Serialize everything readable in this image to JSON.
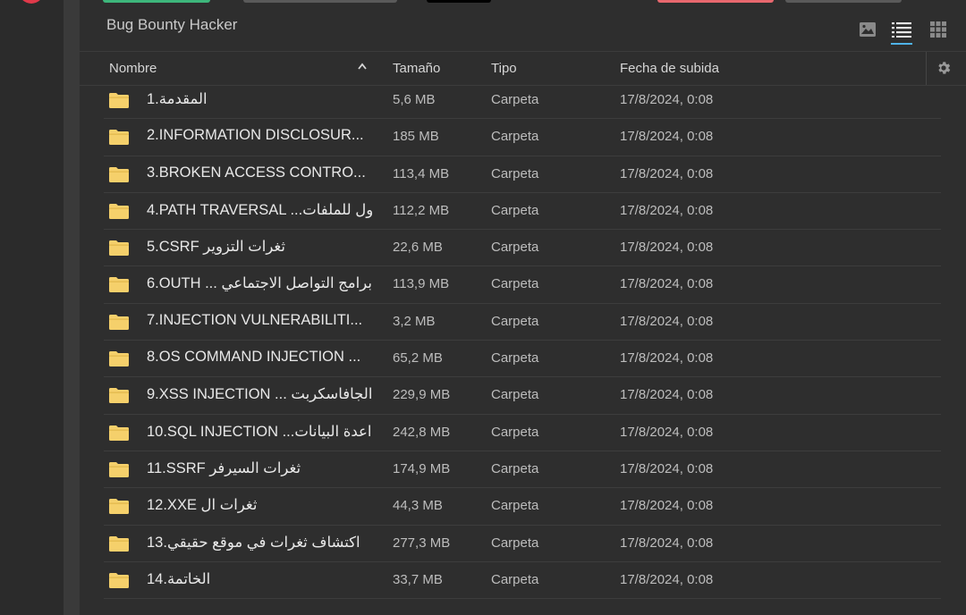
{
  "folder": {
    "title": "Bug Bounty Hacker"
  },
  "view_switcher": {
    "icons": [
      "image-icon",
      "list-icon",
      "grid-icon"
    ],
    "active": "list"
  },
  "table": {
    "headers": {
      "name": "Nombre",
      "size": "Tamaño",
      "type": "Tipo",
      "date": "Fecha de subida"
    },
    "sort": {
      "column": "name",
      "direction": "ascending"
    },
    "rows": [
      {
        "name": "1.المقدمة",
        "size": "5,6 MB",
        "type": "Carpeta",
        "date": "17/8/2024, 0:08"
      },
      {
        "name": "2.INFORMATION DISCLOSUR...",
        "size": "185 MB",
        "type": "Carpeta",
        "date": "17/8/2024, 0:08"
      },
      {
        "name": "3.BROKEN ACCESS CONTRO...",
        "size": "113,4 MB",
        "type": "Carpeta",
        "date": "17/8/2024, 0:08"
      },
      {
        "name": "4.PATH TRAVERSAL ...ول للملفات",
        "size": "112,2 MB",
        "type": "Carpeta",
        "date": "17/8/2024, 0:08"
      },
      {
        "name": "5.CSRF ثغرات التزوير",
        "size": "22,6 MB",
        "type": "Carpeta",
        "date": "17/8/2024, 0:08"
      },
      {
        "name": "6.OUTH ... برامج التواصل الاجتماعي",
        "size": "113,9 MB",
        "type": "Carpeta",
        "date": "17/8/2024, 0:08"
      },
      {
        "name": "7.INJECTION VULNERABILITI...",
        "size": "3,2 MB",
        "type": "Carpeta",
        "date": "17/8/2024, 0:08"
      },
      {
        "name": "8.OS COMMAND INJECTION ...",
        "size": "65,2 MB",
        "type": "Carpeta",
        "date": "17/8/2024, 0:08"
      },
      {
        "name": "9.XSS INJECTION ... الجافاسكربت",
        "size": "229,9 MB",
        "type": "Carpeta",
        "date": "17/8/2024, 0:08"
      },
      {
        "name": "10.SQL INJECTION ...اعدة البيانات",
        "size": "242,8 MB",
        "type": "Carpeta",
        "date": "17/8/2024, 0:08"
      },
      {
        "name": "11.SSRF ثغرات السيرفر",
        "size": "174,9 MB",
        "type": "Carpeta",
        "date": "17/8/2024, 0:08"
      },
      {
        "name": "12.XXE ثغرات ال",
        "size": "44,3 MB",
        "type": "Carpeta",
        "date": "17/8/2024, 0:08"
      },
      {
        "name": "13.اكتشاف ثغرات في موقع حقيقي",
        "size": "277,3 MB",
        "type": "Carpeta",
        "date": "17/8/2024, 0:08"
      },
      {
        "name": "14.الخاتمة",
        "size": "33,7 MB",
        "type": "Carpeta",
        "date": "17/8/2024, 0:08"
      }
    ]
  },
  "colors": {
    "folder_icon": "#f5d06b",
    "accent": "#4fb3e8",
    "background": "#2e2e2e"
  }
}
